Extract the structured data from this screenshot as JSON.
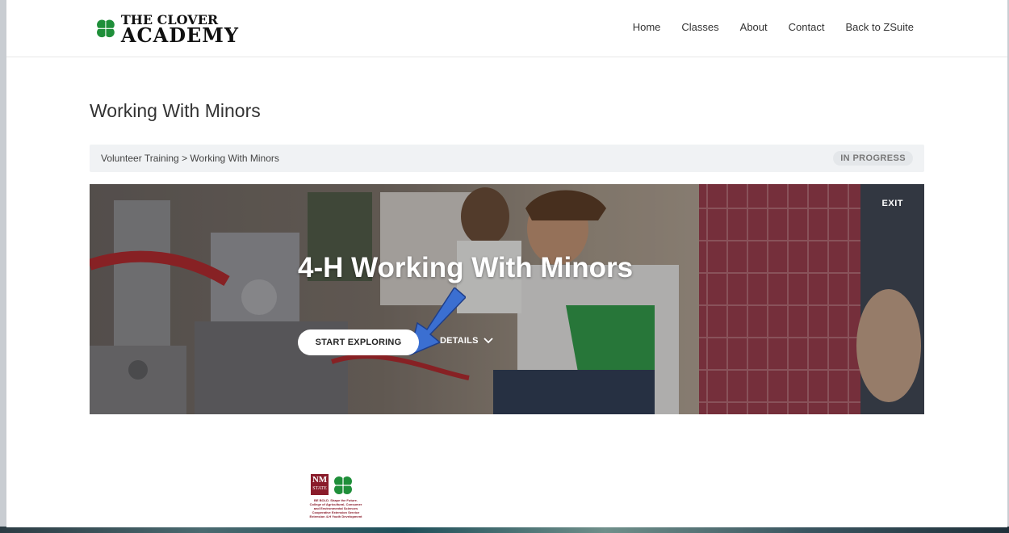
{
  "header": {
    "logo": {
      "line1": "THE CLOVER",
      "line2": "ACADEMY"
    },
    "nav": [
      "Home",
      "Classes",
      "About",
      "Contact",
      "Back to ZSuite"
    ]
  },
  "page": {
    "title": "Working With Minors"
  },
  "breadcrumb": {
    "path": "Volunteer Training > Working With Minors",
    "status": "IN PROGRESS"
  },
  "hero": {
    "title": "4-H Working With Minors",
    "exit_label": "EXIT",
    "start_label": "START EXPLORING",
    "details_label": "DETAILS"
  },
  "footer": {
    "nm_logo": "NM",
    "nm_sub": "STATE",
    "fine_print": [
      "BE BOLD. Shape the Future.",
      "College of Agricultural, Consumer",
      "and Environmental Sciences",
      "Cooperative Extension Service",
      "Extension 4-H Youth Development"
    ]
  },
  "colors": {
    "clover_green": "#1f8f3a",
    "nmsu_crimson": "#8a1c2b",
    "annotation_arrow": "#3b6fd1"
  }
}
